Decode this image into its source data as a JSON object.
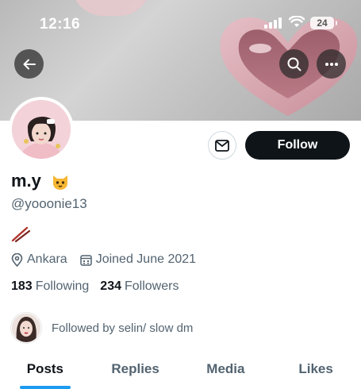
{
  "status_bar": {
    "time": "12:16",
    "battery": "24"
  },
  "actions": {
    "follow_label": "Follow"
  },
  "profile": {
    "display_name": "m.y",
    "name_emoji": "cat-face",
    "handle": "@yooonie13",
    "bio_emoji": "chopsticks",
    "location": "Ankara",
    "joined": "Joined June 2021",
    "following_count": "183",
    "following_label": "Following",
    "followers_count": "234",
    "followers_label": "Followers",
    "followed_by": "Followed by selin/ slow dm"
  },
  "tabs": [
    {
      "label": "Posts",
      "active": true
    },
    {
      "label": "Replies",
      "active": false
    },
    {
      "label": "Media",
      "active": false
    },
    {
      "label": "Likes",
      "active": false
    }
  ],
  "colors": {
    "accent": "#1d9bf0",
    "text": "#0f1419",
    "muted": "#536471"
  }
}
